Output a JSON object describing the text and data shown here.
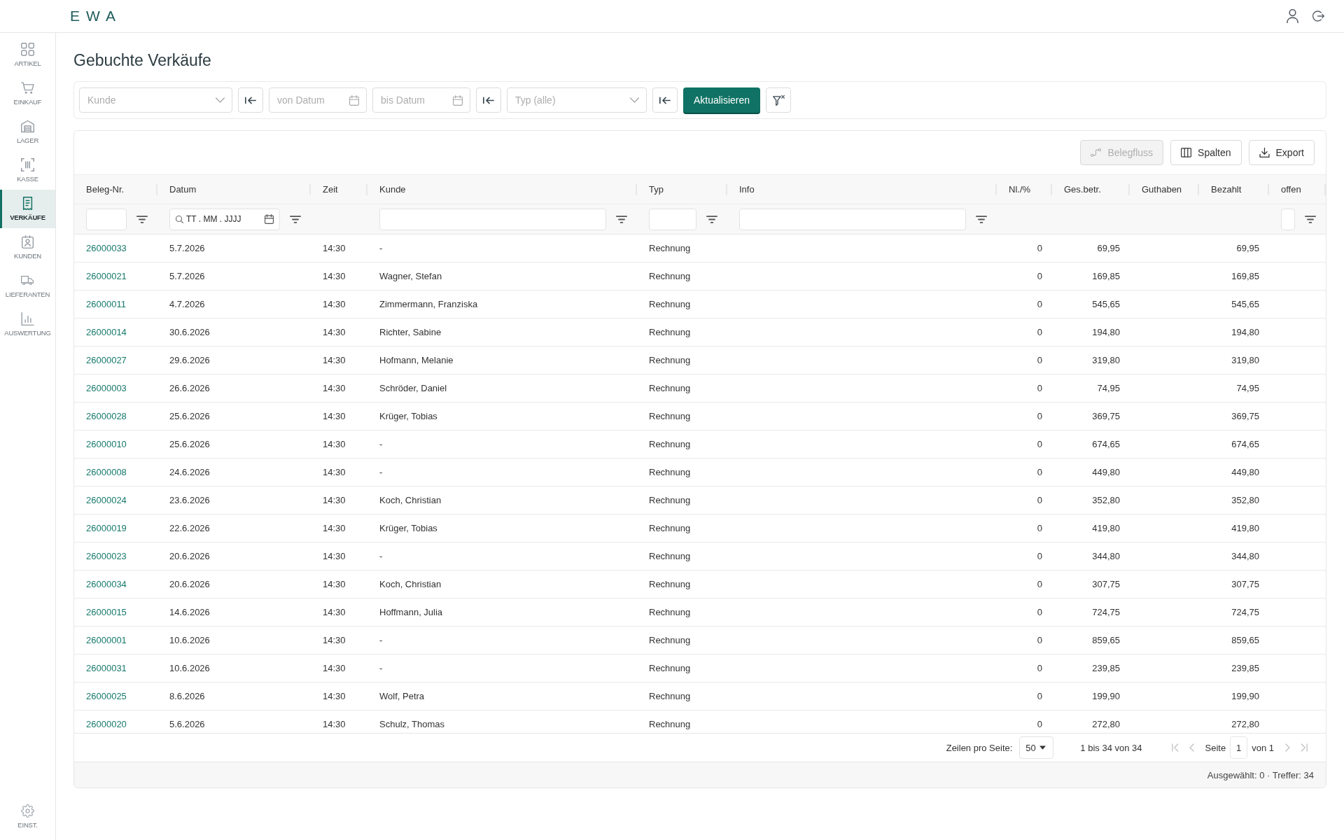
{
  "header": {
    "logo": "EWA"
  },
  "sidebar": {
    "items": [
      {
        "label": "ARTIKEL",
        "selected": false
      },
      {
        "label": "EINKAUF",
        "selected": false
      },
      {
        "label": "LAGER",
        "selected": false
      },
      {
        "label": "KASSE",
        "selected": false
      },
      {
        "label": "VERKÄUFE",
        "selected": true
      },
      {
        "label": "KUNDEN",
        "selected": false
      },
      {
        "label": "LIEFERANTEN",
        "selected": false
      },
      {
        "label": "AUSWERTUNG",
        "selected": false
      }
    ],
    "settings": {
      "label": "EINST."
    }
  },
  "page_title": "Gebuchte Verkäufe",
  "filter_bar": [
    {
      "kind": "select",
      "placeholder": "Kunde"
    },
    {
      "kind": "reset"
    },
    {
      "kind": "date",
      "placeholder": "von Datum"
    },
    {
      "kind": "date",
      "placeholder": "bis Datum"
    },
    {
      "kind": "reset"
    },
    {
      "kind": "select",
      "placeholder": "Typ (alle)"
    },
    {
      "kind": "reset"
    },
    {
      "kind": "primary",
      "label": "Aktualisieren"
    },
    {
      "kind": "clear"
    }
  ],
  "toolbar": {
    "buttons": [
      {
        "label": "Belegfluss",
        "disabled": true
      },
      {
        "label": "Spalten",
        "disabled": false
      },
      {
        "label": "Export",
        "disabled": false
      }
    ]
  },
  "table": {
    "columns": [
      {
        "label": "Beleg-Nr.",
        "filter": {
          "kind": "text"
        }
      },
      {
        "label": "Datum",
        "filter": {
          "kind": "date",
          "placeholder": "TT . MM . JJJJ"
        }
      },
      {
        "label": "Zeit"
      },
      {
        "label": "Kunde",
        "filter": {
          "kind": "text"
        }
      },
      {
        "label": "Typ",
        "filter": {
          "kind": "text"
        }
      },
      {
        "label": "Info",
        "filter": {
          "kind": "text"
        }
      },
      {
        "label": "Nl./%"
      },
      {
        "label": "Ges.betr."
      },
      {
        "label": "Guthaben"
      },
      {
        "label": "Bezahlt"
      },
      {
        "label": "offen",
        "filter": {
          "kind": "text"
        }
      }
    ],
    "rows": [
      {
        "beleg_nr": "26000033",
        "datum": "5.7.2026",
        "zeit": "14:30",
        "kunde": "-",
        "typ": "Rechnung",
        "nl": "0",
        "ges_betr": "69,95",
        "bezahlt": "69,95"
      },
      {
        "beleg_nr": "26000021",
        "datum": "5.7.2026",
        "zeit": "14:30",
        "kunde": "Wagner, Stefan",
        "typ": "Rechnung",
        "nl": "0",
        "ges_betr": "169,85",
        "bezahlt": "169,85"
      },
      {
        "beleg_nr": "26000011",
        "datum": "4.7.2026",
        "zeit": "14:30",
        "kunde": "Zimmermann, Franziska",
        "typ": "Rechnung",
        "nl": "0",
        "ges_betr": "545,65",
        "bezahlt": "545,65"
      },
      {
        "beleg_nr": "26000014",
        "datum": "30.6.2026",
        "zeit": "14:30",
        "kunde": "Richter, Sabine",
        "typ": "Rechnung",
        "nl": "0",
        "ges_betr": "194,80",
        "bezahlt": "194,80"
      },
      {
        "beleg_nr": "26000027",
        "datum": "29.6.2026",
        "zeit": "14:30",
        "kunde": "Hofmann, Melanie",
        "typ": "Rechnung",
        "nl": "0",
        "ges_betr": "319,80",
        "bezahlt": "319,80"
      },
      {
        "beleg_nr": "26000003",
        "datum": "26.6.2026",
        "zeit": "14:30",
        "kunde": "Schröder, Daniel",
        "typ": "Rechnung",
        "nl": "0",
        "ges_betr": "74,95",
        "bezahlt": "74,95"
      },
      {
        "beleg_nr": "26000028",
        "datum": "25.6.2026",
        "zeit": "14:30",
        "kunde": "Krüger, Tobias",
        "typ": "Rechnung",
        "nl": "0",
        "ges_betr": "369,75",
        "bezahlt": "369,75"
      },
      {
        "beleg_nr": "26000010",
        "datum": "25.6.2026",
        "zeit": "14:30",
        "kunde": "-",
        "typ": "Rechnung",
        "nl": "0",
        "ges_betr": "674,65",
        "bezahlt": "674,65"
      },
      {
        "beleg_nr": "26000008",
        "datum": "24.6.2026",
        "zeit": "14:30",
        "kunde": "-",
        "typ": "Rechnung",
        "nl": "0",
        "ges_betr": "449,80",
        "bezahlt": "449,80"
      },
      {
        "beleg_nr": "26000024",
        "datum": "23.6.2026",
        "zeit": "14:30",
        "kunde": "Koch, Christian",
        "typ": "Rechnung",
        "nl": "0",
        "ges_betr": "352,80",
        "bezahlt": "352,80"
      },
      {
        "beleg_nr": "26000019",
        "datum": "22.6.2026",
        "zeit": "14:30",
        "kunde": "Krüger, Tobias",
        "typ": "Rechnung",
        "nl": "0",
        "ges_betr": "419,80",
        "bezahlt": "419,80"
      },
      {
        "beleg_nr": "26000023",
        "datum": "20.6.2026",
        "zeit": "14:30",
        "kunde": "-",
        "typ": "Rechnung",
        "nl": "0",
        "ges_betr": "344,80",
        "bezahlt": "344,80"
      },
      {
        "beleg_nr": "26000034",
        "datum": "20.6.2026",
        "zeit": "14:30",
        "kunde": "Koch, Christian",
        "typ": "Rechnung",
        "nl": "0",
        "ges_betr": "307,75",
        "bezahlt": "307,75"
      },
      {
        "beleg_nr": "26000015",
        "datum": "14.6.2026",
        "zeit": "14:30",
        "kunde": "Hoffmann, Julia",
        "typ": "Rechnung",
        "nl": "0",
        "ges_betr": "724,75",
        "bezahlt": "724,75"
      },
      {
        "beleg_nr": "26000001",
        "datum": "10.6.2026",
        "zeit": "14:30",
        "kunde": "-",
        "typ": "Rechnung",
        "nl": "0",
        "ges_betr": "859,65",
        "bezahlt": "859,65"
      },
      {
        "beleg_nr": "26000031",
        "datum": "10.6.2026",
        "zeit": "14:30",
        "kunde": "-",
        "typ": "Rechnung",
        "nl": "0",
        "ges_betr": "239,85",
        "bezahlt": "239,85"
      },
      {
        "beleg_nr": "26000025",
        "datum": "8.6.2026",
        "zeit": "14:30",
        "kunde": "Wolf, Petra",
        "typ": "Rechnung",
        "nl": "0",
        "ges_betr": "199,90",
        "bezahlt": "199,90"
      },
      {
        "beleg_nr": "26000020",
        "datum": "5.6.2026",
        "zeit": "14:30",
        "kunde": "Schulz, Thomas",
        "typ": "Rechnung",
        "nl": "0",
        "ges_betr": "272,80",
        "bezahlt": "272,80"
      }
    ]
  },
  "pagination": {
    "rows_per_page_label": "Zeilen pro Seite:",
    "rows_per_page": "50",
    "range": "1 bis 34 von 34",
    "page_label": "Seite",
    "page": "1",
    "page_total": "von 1",
    "nav_buttons": [
      {
        "kind": "first",
        "disabled": true
      },
      {
        "kind": "prev",
        "disabled": true
      },
      {
        "kind": "next",
        "disabled": true
      },
      {
        "kind": "last",
        "disabled": true
      }
    ]
  },
  "status_bar": {
    "text": "Ausgewählt: 0 · Treffer: 34"
  }
}
